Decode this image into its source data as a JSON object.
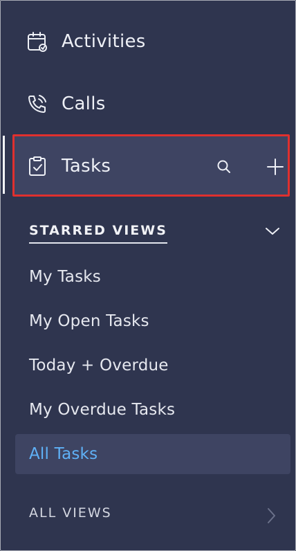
{
  "nav": {
    "activities": {
      "label": "Activities",
      "icon": "calendar-icon"
    },
    "calls": {
      "label": "Calls",
      "icon": "phone-icon"
    },
    "tasks": {
      "label": "Tasks",
      "icon": "clipboard-check-icon"
    }
  },
  "starred_views": {
    "title": "STARRED VIEWS",
    "items": [
      {
        "label": "My Tasks"
      },
      {
        "label": "My Open Tasks"
      },
      {
        "label": "Today + Overdue"
      },
      {
        "label": "My Overdue Tasks"
      },
      {
        "label": "All Tasks",
        "selected": true
      }
    ]
  },
  "all_views": {
    "label": "ALL VIEWS"
  },
  "colors": {
    "background": "#2f354f",
    "selected_background": "#3e4462",
    "selected_text": "#5fb1f7",
    "highlight_border": "#e0302e"
  }
}
